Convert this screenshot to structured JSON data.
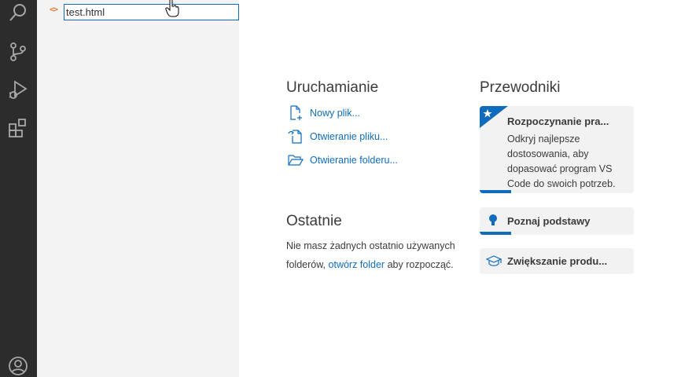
{
  "explorer": {
    "rename_value": "test.html",
    "file_icon_glyph": "<>",
    "file_icon_name": "html-file-icon"
  },
  "activity_bar": {
    "icons": [
      "search-icon",
      "source-control-icon",
      "run-debug-icon",
      "extensions-icon",
      "account-icon"
    ]
  },
  "welcome": {
    "start": {
      "title": "Uruchamianie",
      "items": [
        {
          "label": "Nowy plik...",
          "icon": "new-file-icon"
        },
        {
          "label": "Otwieranie pliku...",
          "icon": "open-file-icon"
        },
        {
          "label": "Otwieranie folderu...",
          "icon": "open-folder-icon"
        }
      ]
    },
    "recent": {
      "title": "Ostatnie",
      "text_before": "Nie masz żadnych ostatnio używanych folderów,",
      "link": "otwórz folder",
      "text_after": "aby rozpocząć."
    },
    "walkthroughs": {
      "title": "Przewodniki",
      "cards": [
        {
          "title": "Rozpoczynanie pra...",
          "description": "Odkryj najlepsze dostosowania, aby dopasować program VS Code do swoich potrzeb.",
          "icon": "star-icon",
          "progress": 0.2
        },
        {
          "title": "Poznaj podstawy",
          "icon": "lightbulb-icon",
          "progress": 0.2
        },
        {
          "title": "Zwiększanie produ...",
          "icon": "mortarboard-icon",
          "progress": 0
        }
      ]
    }
  },
  "colors": {
    "accent": "#0f6cbd",
    "activity_bar": "#2c2c2c",
    "sidebar": "#f3f3f3"
  }
}
